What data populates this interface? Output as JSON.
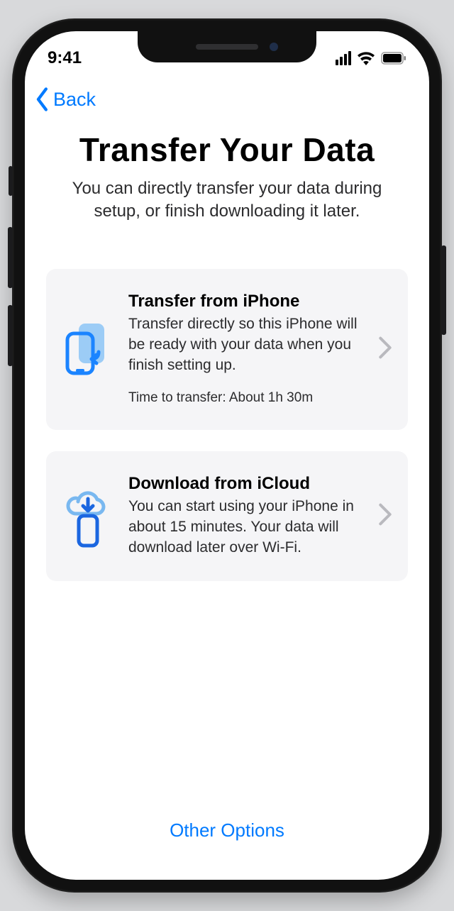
{
  "statusbar": {
    "time": "9:41"
  },
  "nav": {
    "back_label": "Back"
  },
  "header": {
    "title": "Transfer Your Data",
    "subtitle": "You can directly transfer your data during setup, or finish downloading it later."
  },
  "options": [
    {
      "id": "transfer-from-iphone",
      "icon": "transfer-phones-icon",
      "title": "Transfer from iPhone",
      "body": "Transfer directly so this iPhone will be ready with your data when you finish setting up.",
      "estimate": "Time to transfer: About 1h 30m"
    },
    {
      "id": "download-from-icloud",
      "icon": "icloud-download-icon",
      "title": "Download from iCloud",
      "body": "You can start using your iPhone in about 15 minutes. Your data will download later over Wi-Fi.",
      "estimate": null
    }
  ],
  "footer": {
    "other_options_label": "Other Options"
  },
  "colors": {
    "accent": "#007aff",
    "accent_light": "#6bb5f5",
    "card_bg": "#f5f5f7",
    "chevron": "#b9b9be"
  }
}
